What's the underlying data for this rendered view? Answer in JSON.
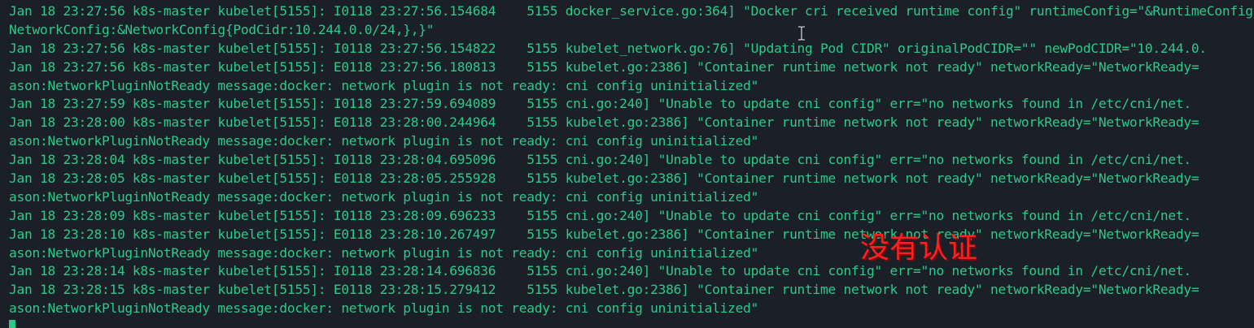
{
  "terminal": {
    "lines": [
      "Jan 18 23:27:56 k8s-master kubelet[5155]: I0118 23:27:56.154684    5155 docker_service.go:364] \"Docker cri received runtime config\" runtimeConfig=\"&RuntimeConfig{",
      "NetworkConfig:&NetworkConfig{PodCidr:10.244.0.0/24,},}\"",
      "Jan 18 23:27:56 k8s-master kubelet[5155]: I0118 23:27:56.154822    5155 kubelet_network.go:76] \"Updating Pod CIDR\" originalPodCIDR=\"\" newPodCIDR=\"10.244.0.",
      "Jan 18 23:27:56 k8s-master kubelet[5155]: E0118 23:27:56.180813    5155 kubelet.go:2386] \"Container runtime network not ready\" networkReady=\"NetworkReady=",
      "ason:NetworkPluginNotReady message:docker: network plugin is not ready: cni config uninitialized\"",
      "Jan 18 23:27:59 k8s-master kubelet[5155]: I0118 23:27:59.694089    5155 cni.go:240] \"Unable to update cni config\" err=\"no networks found in /etc/cni/net.",
      "Jan 18 23:28:00 k8s-master kubelet[5155]: E0118 23:28:00.244964    5155 kubelet.go:2386] \"Container runtime network not ready\" networkReady=\"NetworkReady=",
      "ason:NetworkPluginNotReady message:docker: network plugin is not ready: cni config uninitialized\"",
      "Jan 18 23:28:04 k8s-master kubelet[5155]: I0118 23:28:04.695096    5155 cni.go:240] \"Unable to update cni config\" err=\"no networks found in /etc/cni/net.",
      "Jan 18 23:28:05 k8s-master kubelet[5155]: E0118 23:28:05.255928    5155 kubelet.go:2386] \"Container runtime network not ready\" networkReady=\"NetworkReady=",
      "ason:NetworkPluginNotReady message:docker: network plugin is not ready: cni config uninitialized\"",
      "Jan 18 23:28:09 k8s-master kubelet[5155]: I0118 23:28:09.696233    5155 cni.go:240] \"Unable to update cni config\" err=\"no networks found in /etc/cni/net.",
      "Jan 18 23:28:10 k8s-master kubelet[5155]: E0118 23:28:10.267497    5155 kubelet.go:2386] \"Container runtime network not ready\" networkReady=\"NetworkReady=",
      "ason:NetworkPluginNotReady message:docker: network plugin is not ready: cni config uninitialized\"",
      "Jan 18 23:28:14 k8s-master kubelet[5155]: I0118 23:28:14.696836    5155 cni.go:240] \"Unable to update cni config\" err=\"no networks found in /etc/cni/net.",
      "Jan 18 23:28:15 k8s-master kubelet[5155]: E0118 23:28:15.279412    5155 kubelet.go:2386] \"Container runtime network not ready\" networkReady=\"NetworkReady=",
      "ason:NetworkPluginNotReady message:docker: network plugin is not ready: cni config uninitialized\""
    ],
    "text_color": "#2dc98a",
    "background_color": "#1b1f27",
    "cursor_icon": "text-ibeam-icon"
  },
  "annotation": {
    "text": "没有认证",
    "color": "#ff1f1f"
  }
}
